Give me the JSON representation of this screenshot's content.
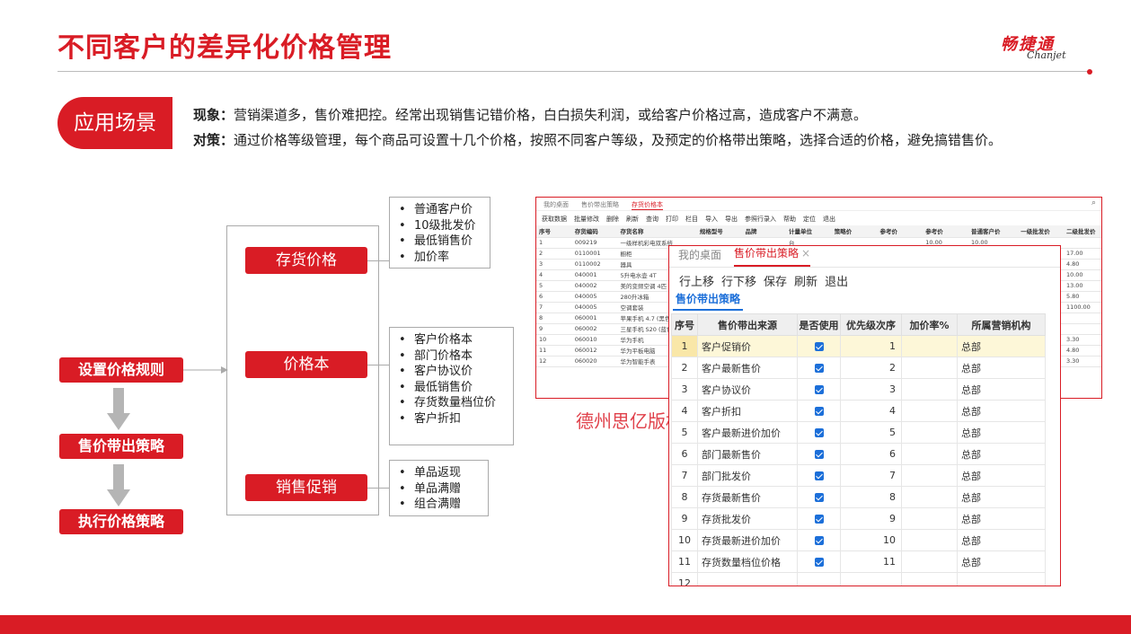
{
  "title": "不同客户的差异化价格管理",
  "logo": {
    "cn": "畅捷通",
    "en": "Chanjet"
  },
  "scene": {
    "badge": "应用场景",
    "line1_label": "现象：",
    "line1_text": "营销渠道多，售价难把控。经常出现销售记错价格，白白损失利润，或给客户价格过高，造成客户不满意。",
    "line2_label": "对策：",
    "line2_text": "通过价格等级管理，每个商品可设置十几个价格，按照不同客户等级，及预定的价格带出策略，选择合适的价格，避免搞错售价。"
  },
  "flow": {
    "step1": "设置价格规则",
    "step2": "售价带出策略",
    "step3": "执行价格策略"
  },
  "categories": [
    {
      "label": "存货价格",
      "items": [
        "普通客户价",
        "10级批发价",
        "最低销售价",
        "加价率"
      ]
    },
    {
      "label": "价格本",
      "items": [
        "客户价格本",
        "部门价格本",
        "客户协议价",
        "最低销售价",
        "存货数量档位价",
        "客户折扣"
      ]
    },
    {
      "label": "销售促销",
      "items": [
        "单品返现",
        "单品满赠",
        "组合满赠"
      ]
    }
  ],
  "back_window": {
    "tabs": [
      "我的桌面",
      "售价带出策略",
      "存货价格本"
    ],
    "toolbar": [
      "获取数据",
      "批量修改",
      "删除",
      "刷新",
      "查询",
      "打印",
      "栏目",
      "导入",
      "导出",
      "参照行录入",
      "帮助",
      "定位",
      "退出"
    ],
    "headers": [
      "序号",
      "",
      "存货编码",
      "存货名称",
      "规格型号",
      "品牌",
      "计量单位",
      "策略价",
      "参考价",
      "参考价",
      "普通客户价",
      "一级批发价",
      "二级批发价"
    ],
    "rows": [
      [
        "1",
        "",
        "009219",
        "一级样机彩电双系统",
        "",
        "",
        "台",
        "",
        "",
        "10.00",
        "10.00",
        "",
        ""
      ],
      [
        "2",
        "",
        "0110001",
        "橱柜",
        "",
        "",
        "",
        "",
        "",
        "",
        "",
        "",
        "17.00"
      ],
      [
        "3",
        "",
        "0110002",
        "器具",
        "",
        "",
        "",
        "",
        "",
        "",
        "",
        "",
        "4.80"
      ],
      [
        "4",
        "",
        "040001",
        "5升电水壶 4T",
        "",
        "",
        "",
        "",
        "",
        "",
        "",
        "",
        "10.00"
      ],
      [
        "5",
        "",
        "040002",
        "美的变频空调 4匹 24寸",
        "",
        "",
        "",
        "",
        "",
        "",
        "",
        "",
        "13.00"
      ],
      [
        "6",
        "",
        "040005",
        "280升冰箱",
        "",
        "",
        "",
        "",
        "",
        "",
        "",
        "",
        "5.80"
      ],
      [
        "7",
        "",
        "040005",
        "空调套装",
        "",
        "",
        "",
        "",
        "",
        "",
        "",
        "",
        "1100.00"
      ],
      [
        "8",
        "",
        "060001",
        "苹果手机 4.7 (黑色)",
        "",
        "",
        "",
        "",
        "",
        "",
        "",
        "",
        ""
      ],
      [
        "9",
        "",
        "060002",
        "三星手机 S20 (蓝色)",
        "",
        "",
        "",
        "",
        "",
        "",
        "",
        "",
        ""
      ],
      [
        "10",
        "",
        "060010",
        "华为手机",
        "",
        "",
        "",
        "",
        "",
        "",
        "",
        "",
        "3.30"
      ],
      [
        "11",
        "",
        "060012",
        "华为平板电脑",
        "",
        "",
        "",
        "",
        "",
        "",
        "",
        "",
        "4.80"
      ],
      [
        "12",
        "",
        "060020",
        "华为智能手表",
        "",
        "",
        "",
        "",
        "",
        "",
        "",
        "",
        "3.30"
      ]
    ]
  },
  "watermark": "德州思亿版权",
  "front_window": {
    "tab_desktop": "我的桌面",
    "tab_active": "售价带出策略",
    "close": "×",
    "toolbar": [
      "行上移",
      "行下移",
      "保存",
      "刷新",
      "退出"
    ],
    "subtab": "售价带出策略",
    "headers": [
      "序号",
      "售价带出来源",
      "是否使用",
      "优先级次序",
      "加价率%",
      "所属营销机构"
    ],
    "rows": [
      {
        "no": "1",
        "source": "客户促销价",
        "used": true,
        "priority": "1",
        "markup": "",
        "org": "总部"
      },
      {
        "no": "2",
        "source": "客户最新售价",
        "used": true,
        "priority": "2",
        "markup": "",
        "org": "总部"
      },
      {
        "no": "3",
        "source": "客户协议价",
        "used": true,
        "priority": "3",
        "markup": "",
        "org": "总部"
      },
      {
        "no": "4",
        "source": "客户折扣",
        "used": true,
        "priority": "4",
        "markup": "",
        "org": "总部"
      },
      {
        "no": "5",
        "source": "客户最新进价加价",
        "used": true,
        "priority": "5",
        "markup": "",
        "org": "总部"
      },
      {
        "no": "6",
        "source": "部门最新售价",
        "used": true,
        "priority": "6",
        "markup": "",
        "org": "总部"
      },
      {
        "no": "7",
        "source": "部门批发价",
        "used": true,
        "priority": "7",
        "markup": "",
        "org": "总部"
      },
      {
        "no": "8",
        "source": "存货最新售价",
        "used": true,
        "priority": "8",
        "markup": "",
        "org": "总部"
      },
      {
        "no": "9",
        "source": "存货批发价",
        "used": true,
        "priority": "9",
        "markup": "",
        "org": "总部"
      },
      {
        "no": "10",
        "source": "存货最新进价加价",
        "used": true,
        "priority": "10",
        "markup": "",
        "org": "总部"
      },
      {
        "no": "11",
        "source": "存货数量档位价格",
        "used": true,
        "priority": "11",
        "markup": "",
        "org": "总部"
      },
      {
        "no": "12",
        "source": "",
        "used": false,
        "priority": "",
        "markup": "",
        "org": ""
      }
    ]
  },
  "colors": {
    "brand_red": "#d91c25",
    "tab_blue": "#1c6fd9",
    "selected_row": "#fdf7d8"
  }
}
